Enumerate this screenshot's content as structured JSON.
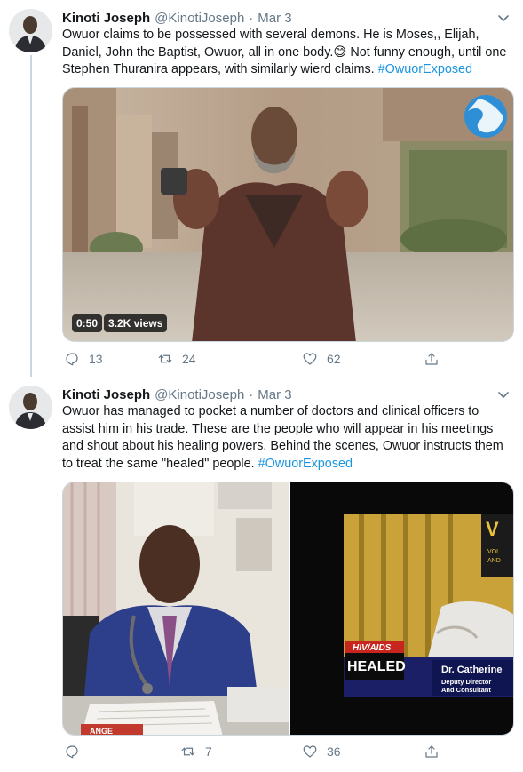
{
  "tweets": [
    {
      "author_name": "Kinoti Joseph",
      "handle": "@KinotiJoseph",
      "separator": "·",
      "date": "Mar 3",
      "text": "Owuor claims to be possessed with several demons. He is Moses,, Elijah, Daniel, John the Baptist, Owuor, all in one body.",
      "emoji": "😅",
      "text_after_emoji": " Not funny enough, until one Stephen Thuranira appears, with similarly wierd claims. ",
      "hashtag": "#OwuorExposed",
      "video": {
        "duration": "0:50",
        "views": "3.2K views"
      },
      "replies": "13",
      "retweets": "24",
      "likes": "62"
    },
    {
      "author_name": "Kinoti Joseph",
      "handle": "@KinotiJoseph",
      "separator": "·",
      "date": "Mar 3",
      "text": "Owuor has managed to pocket a number of doctors and clinical officers to assist him in his trade. These are the people who will appear in his meetings and shout about his healing powers. Behind the scenes, Owuor instructs them to treat the same \"healed\" people. ",
      "hashtag": "#OwuorExposed",
      "image_right": {
        "badge_top": "HIV/AIDS",
        "badge_main": "HEALED",
        "caption_name": "Dr. Catherine",
        "caption_line1": "Deputy Director",
        "caption_line2": "And Consultant",
        "corner_text": "V",
        "corner_sub1": "VOL",
        "corner_sub2": "AND"
      },
      "image_left": {
        "book_text": "ANGE"
      },
      "replies": "",
      "retweets": "7",
      "likes": "36"
    }
  ],
  "colors": {
    "link": "#1b95e0",
    "muted": "#657786",
    "border": "#ccd6dd"
  },
  "icons": [
    "avatar",
    "chevron-down-icon",
    "reply-icon",
    "retweet-icon",
    "like-icon",
    "share-icon",
    "globe-logo-icon"
  ]
}
